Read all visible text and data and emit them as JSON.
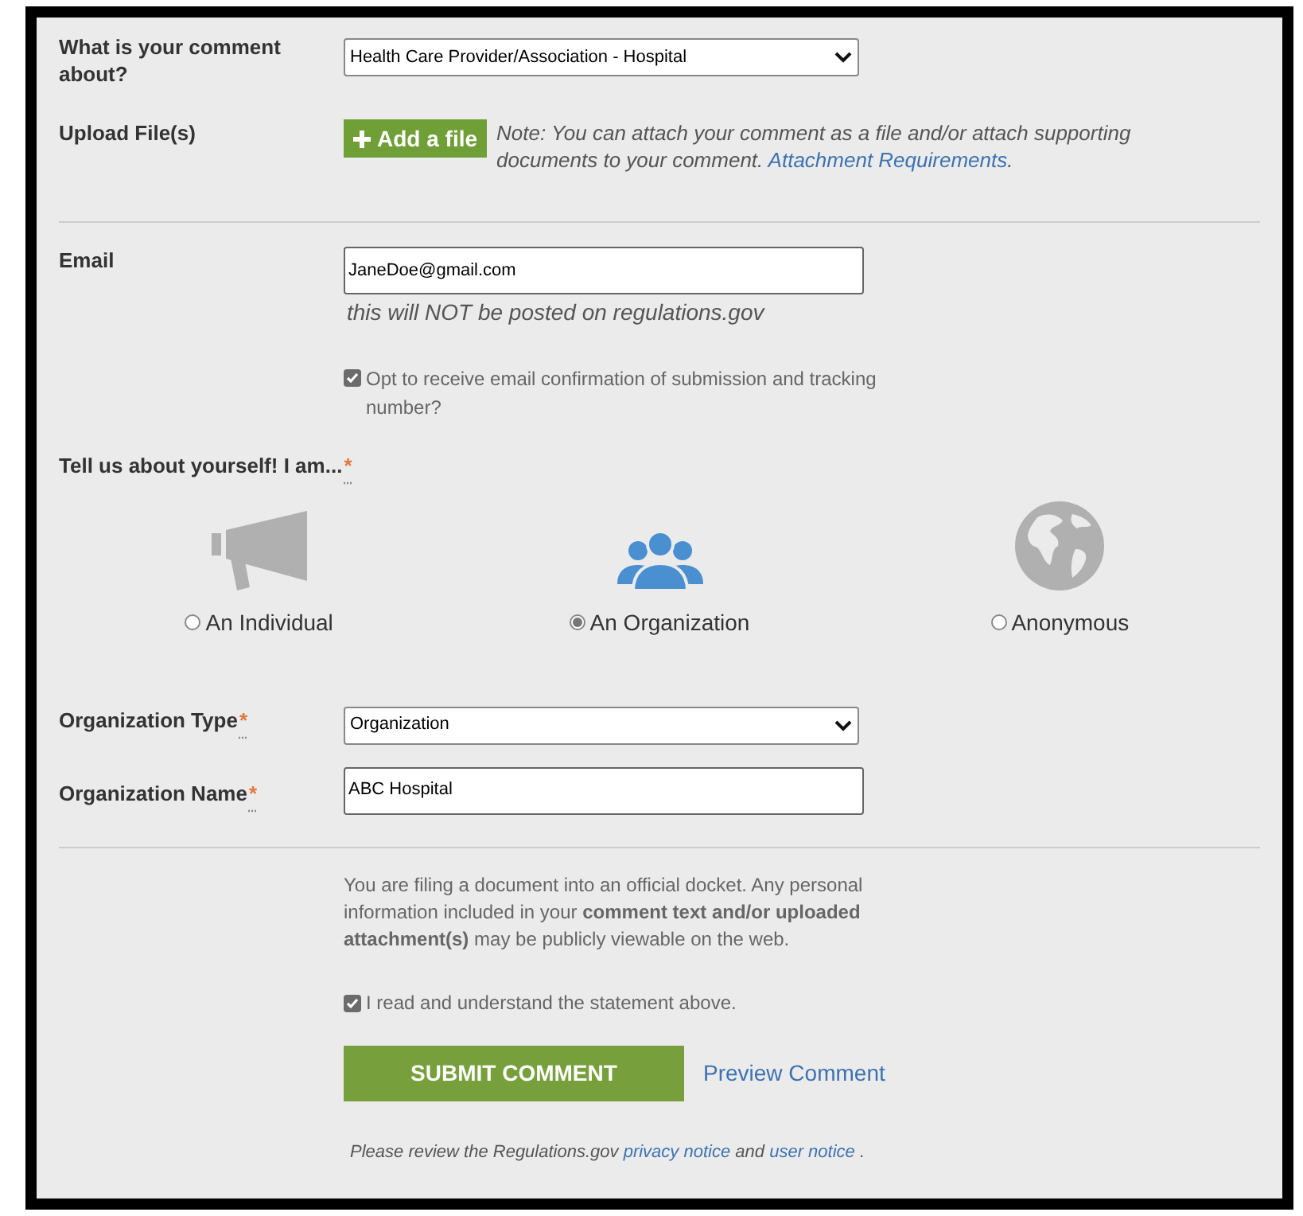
{
  "comment_about": {
    "label": "What is your comment about?",
    "value": "Health Care Provider/Association - Hospital"
  },
  "upload": {
    "label": "Upload File(s)",
    "button": "Add a file",
    "note": "Note: You can attach your comment as a file and/or attach supporting documents to your comment.",
    "link": "Attachment Requirements",
    "note_end": "."
  },
  "email": {
    "label": "Email",
    "value": "JaneDoe@gmail.com",
    "hint": "this will NOT be posted on regulations.gov",
    "opt_in": {
      "label": "Opt to receive email confirmation of submission and tracking number?",
      "checked": true
    }
  },
  "about_yourself": {
    "label": "Tell us about yourself! I am...",
    "required_mark": "*",
    "options": [
      {
        "kind": "megaphone",
        "label": "An Individual",
        "selected": false
      },
      {
        "kind": "people",
        "label": "An Organization",
        "selected": true
      },
      {
        "kind": "globe",
        "label": "Anonymous",
        "selected": false
      }
    ]
  },
  "organization_type": {
    "label": "Organization Type",
    "required_mark": "*",
    "value": "Organization"
  },
  "organization_name": {
    "label": "Organization Name",
    "required_mark": "*",
    "value": "ABC Hospital"
  },
  "disclosure": "You are filing a document into an official docket. Any personal information included in your **comment text and/or uploaded attachment(s)** may be publicly viewable on the web.",
  "acknowledge": {
    "label": "I read and understand the statement above.",
    "checked": true
  },
  "submit_button": "SUBMIT COMMENT",
  "preview_link": "Preview Comment",
  "footer": {
    "prefix": "Please review the Regulations.gov",
    "links": [
      "privacy notice",
      "user notice"
    ],
    "joiner": "and",
    "suffix": "."
  }
}
